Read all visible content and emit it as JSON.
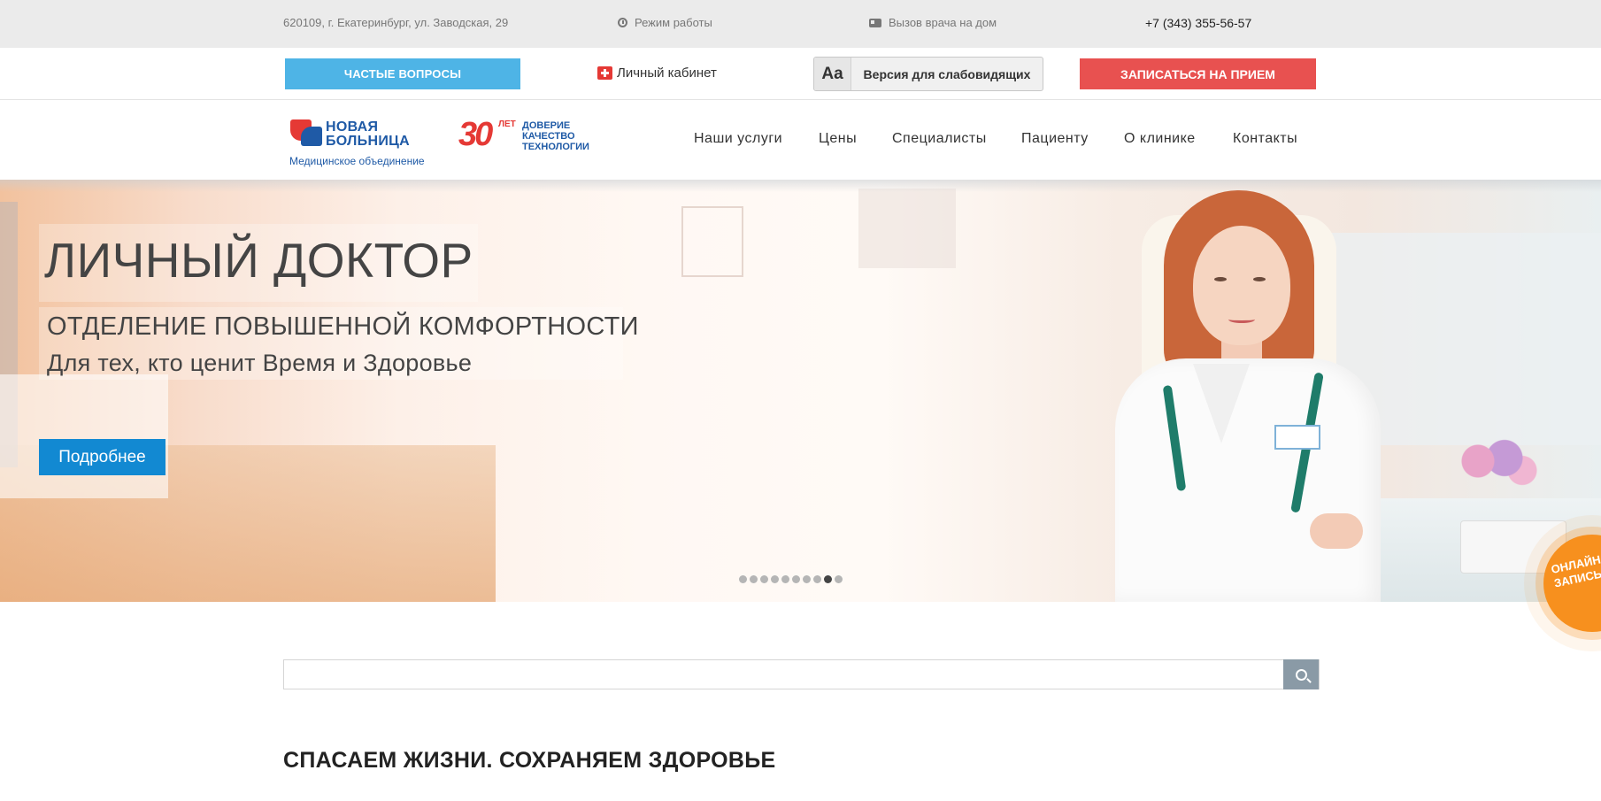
{
  "topbar": {
    "address": "620109, г. Екатеринбург, ул. Заводская, 29",
    "hours": "Режим работы",
    "home_visit": "Вызов врача на дом",
    "phone": "+7 (343) 355-56-57"
  },
  "actionbar": {
    "faq_label": "ЧАСТЫЕ ВОПРОСЫ",
    "cabinet_label": "Личный кабинет",
    "vision_aa": "Aa",
    "vision_label": "Версия для слабовидящих",
    "signup_label": "ЗАПИСАТЬСЯ НА ПРИЕМ"
  },
  "logo": {
    "name_line1": "НОВАЯ",
    "name_line2": "БОЛЬНИЦА",
    "subtitle": "Медицинское объединение",
    "anniv_number": "30",
    "anniv_let": "ЛЕТ",
    "anniv_word1": "ДОВЕРИЕ",
    "anniv_word2": "КАЧЕСТВО",
    "anniv_word3": "ТЕХНОЛОГИИ"
  },
  "nav": {
    "items": [
      {
        "label": "Наши услуги"
      },
      {
        "label": "Цены"
      },
      {
        "label": "Специалисты"
      },
      {
        "label": "Пациенту"
      },
      {
        "label": "О клинике"
      },
      {
        "label": "Контакты"
      }
    ]
  },
  "hero": {
    "title": "ЛИЧНЫЙ ДОКТОР",
    "subtitle": "ОТДЕЛЕНИЕ ПОВЫШЕННОЙ КОМФОРТНОСТИ",
    "tagline": "Для тех, кто ценит Время и Здоровье",
    "button_label": "Подробнее",
    "slide_count": 10,
    "active_slide": 9
  },
  "online_badge": {
    "line1": "ОНЛАЙН",
    "line2": "ЗАПИСЬ"
  },
  "search": {
    "value": "",
    "placeholder": ""
  },
  "section": {
    "title": "СПАСАЕМ ЖИЗНИ. СОХРАНЯЕМ ЗДОРОВЬЕ"
  },
  "colors": {
    "faq_button": "#4eb4e6",
    "signup_button": "#e85150",
    "more_button": "#1289d2",
    "brand_blue": "#1f5aa6",
    "brand_red": "#e53935",
    "online_badge": "#f7901e"
  },
  "icons": {
    "hours": "clock-icon",
    "home_visit": "ambulance-icon",
    "cabinet": "medical-kit-icon",
    "search": "search-icon"
  }
}
